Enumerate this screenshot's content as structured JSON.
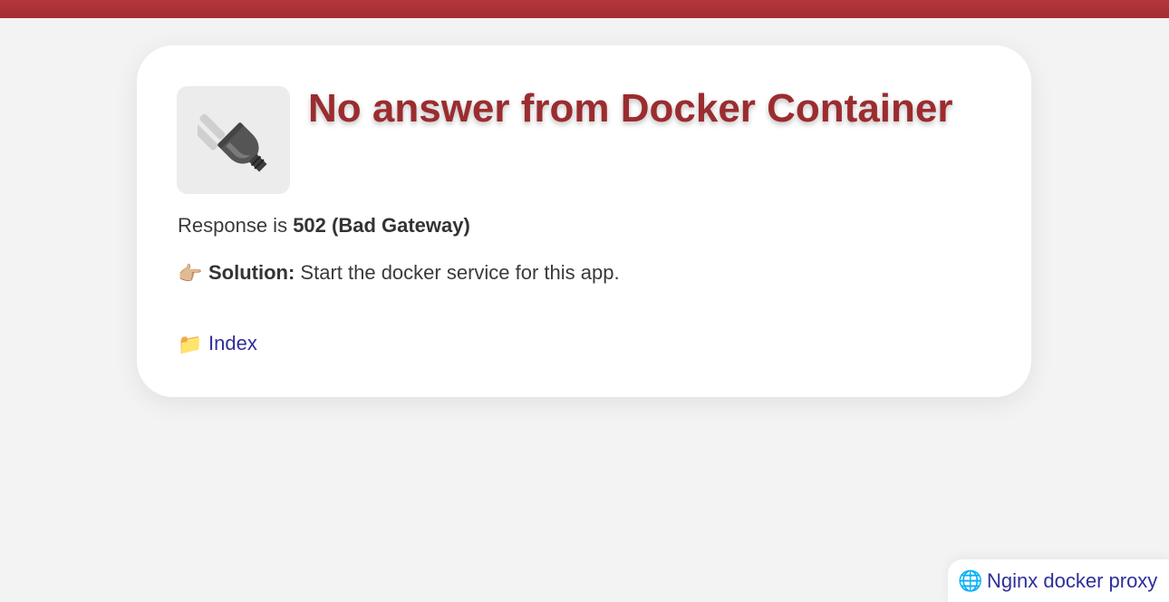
{
  "header": {
    "bar_color": "#aa3237"
  },
  "card": {
    "icon": "electric-plug-icon",
    "title": "No answer from Docker Container",
    "response": {
      "prefix": "Response is ",
      "status": "502 (Bad Gateway)"
    },
    "solution": {
      "icon": "pointing-hand-icon",
      "label": "Solution:",
      "text": " Start the docker service for this app."
    },
    "index_link": {
      "icon": "folder-icon",
      "label": "Index"
    }
  },
  "footer": {
    "icon": "globe-icon",
    "label": "Nginx docker proxy"
  },
  "colors": {
    "accent": "#9b2c2f",
    "link": "#2e2f9a",
    "background": "#f3f3f3"
  }
}
